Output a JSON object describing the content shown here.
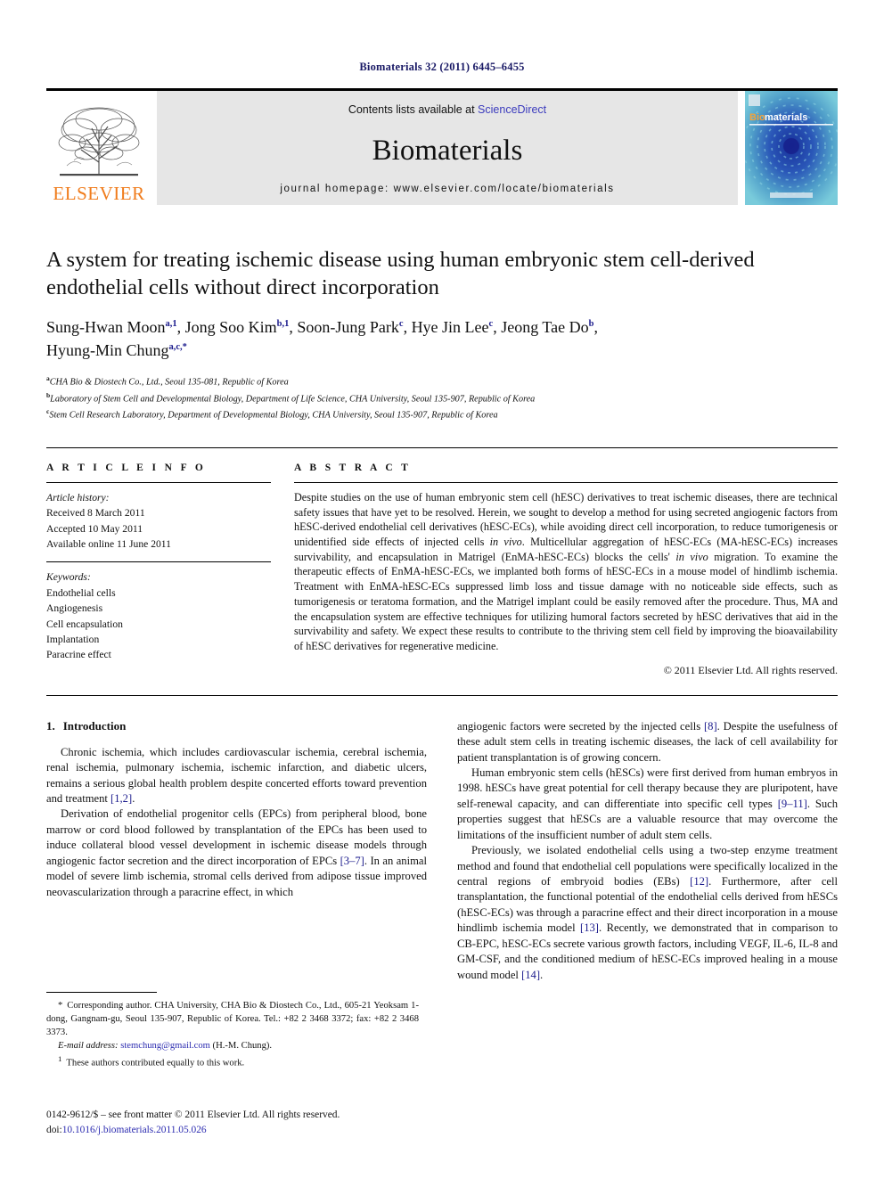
{
  "running_head": "Biomaterials 32 (2011) 6445–6455",
  "masthead": {
    "publisher_wordmark": "ELSEVIER",
    "contents_prefix": "Contents lists available at ",
    "contents_link": "ScienceDirect",
    "journal_name": "Biomaterials",
    "homepage_line": "journal homepage: www.elsevier.com/locate/biomaterials",
    "cover_title_prefix": "Bio",
    "cover_title_suffix": "materials",
    "accent_orange": "#f07c1c",
    "link_blue": "#3b3bbd",
    "cover_teal": "#6fc6d9",
    "cover_blue": "#1b3fa0"
  },
  "article": {
    "title": "A system for treating ischemic disease using human embryonic stem cell-derived endothelial cells without direct incorporation",
    "authors_line_1": "Sung-Hwan Moon",
    "authors": [
      {
        "name": "Sung-Hwan Moon",
        "sup": "a,1"
      },
      {
        "name": "Jong Soo Kim",
        "sup": "b,1"
      },
      {
        "name": "Soon-Jung Park",
        "sup": "c"
      },
      {
        "name": "Hye Jin Lee",
        "sup": "c"
      },
      {
        "name": "Jeong Tae Do",
        "sup": "b"
      },
      {
        "name": "Hyung-Min Chung",
        "sup": "a,c,*"
      }
    ],
    "affiliations": [
      {
        "mark": "a",
        "text": "CHA Bio & Diostech Co., Ltd., Seoul 135-081, Republic of Korea"
      },
      {
        "mark": "b",
        "text": "Laboratory of Stem Cell and Developmental Biology, Department of Life Science, CHA University, Seoul 135-907, Republic of Korea"
      },
      {
        "mark": "c",
        "text": "Stem Cell Research Laboratory, Department of Developmental Biology, CHA University, Seoul 135-907, Republic of Korea"
      }
    ]
  },
  "article_info": {
    "heading": "A R T I C L E   I N F O",
    "history_label": "Article history:",
    "history": [
      "Received 8 March 2011",
      "Accepted 10 May 2011",
      "Available online 11 June 2011"
    ],
    "keywords_label": "Keywords:",
    "keywords": [
      "Endothelial cells",
      "Angiogenesis",
      "Cell encapsulation",
      "Implantation",
      "Paracrine effect"
    ]
  },
  "abstract": {
    "heading": "A B S T R A C T",
    "paragraph_1": "Despite studies on the use of human embryonic stem cell (hESC) derivatives to treat ischemic diseases, there are technical safety issues that have yet to be resolved. Herein, we sought to develop a method for using secreted angiogenic factors from hESC-derived endothelial cell derivatives (hESC-ECs), while avoiding direct cell incorporation, to reduce tumorigenesis or unidentified side effects of injected cells ",
    "italic_1": "in vivo",
    "paragraph_2": ". Multicellular aggregation of hESC-ECs (MA-hESC-ECs) increases survivability, and encapsulation in Matrigel (EnMA-hESC-ECs) blocks the cells' ",
    "italic_2": "in vivo",
    "paragraph_3": " migration. To examine the therapeutic effects of EnMA-hESC-ECs, we implanted both forms of hESC-ECs in a mouse model of hindlimb ischemia. Treatment with EnMA-hESC-ECs suppressed limb loss and tissue damage with no noticeable side effects, such as tumorigenesis or teratoma formation, and the Matrigel implant could be easily removed after the procedure. Thus, MA and the encapsulation system are effective techniques for utilizing humoral factors secreted by hESC derivatives that aid in the survivability and safety. We expect these results to contribute to the thriving stem cell field by improving the bioavailability of hESC derivatives for regenerative medicine.",
    "copyright": "© 2011 Elsevier Ltd. All rights reserved."
  },
  "introduction": {
    "section_number": "1.",
    "section_title": "Introduction",
    "left_p1_a": "Chronic ischemia, which includes cardiovascular ischemia, cerebral ischemia, renal ischemia, pulmonary ischemia, ischemic infarction, and diabetic ulcers, remains a serious global health problem despite concerted efforts toward prevention and treatment ",
    "left_p1_cite": "[1,2]",
    "left_p1_b": ".",
    "left_p2_a": "Derivation of endothelial progenitor cells (EPCs) from peripheral blood, bone marrow or cord blood followed by transplantation of the EPCs has been used to induce collateral blood vessel development in ischemic disease models through angiogenic factor secretion and the direct incorporation of EPCs ",
    "left_p2_cite": "[3–7]",
    "left_p2_b": ". In an animal model of severe limb ischemia, stromal cells derived from adipose tissue improved neovascularization through a paracrine effect, in which",
    "right_p1_a": "angiogenic factors were secreted by the injected cells ",
    "right_p1_cite": "[8]",
    "right_p1_b": ". Despite the usefulness of these adult stem cells in treating ischemic diseases, the lack of cell availability for patient transplantation is of growing concern.",
    "right_p2_a": "Human embryonic stem cells (hESCs) were first derived from human embryos in 1998. hESCs have great potential for cell therapy because they are pluripotent, have self-renewal capacity, and can differentiate into specific cell types ",
    "right_p2_cite": "[9–11]",
    "right_p2_b": ". Such properties suggest that hESCs are a valuable resource that may overcome the limitations of the insufficient number of adult stem cells.",
    "right_p3_a": "Previously, we isolated endothelial cells using a two-step enzyme treatment method and found that endothelial cell populations were specifically localized in the central regions of embryoid bodies (EBs) ",
    "right_p3_cite1": "[12]",
    "right_p3_b": ". Furthermore, after cell transplantation, the functional potential of the endothelial cells derived from hESCs (hESC-ECs) was through a paracrine effect and their direct incorporation in a mouse hindlimb ischemia model ",
    "right_p3_cite2": "[13]",
    "right_p3_c": ". Recently, we demonstrated that in comparison to CB-EPC, hESC-ECs secrete various growth factors, including VEGF, IL-6, IL-8 and GM-CSF, and the conditioned medium of hESC-ECs improved healing in a mouse wound model ",
    "right_p3_cite3": "[14]",
    "right_p3_d": "."
  },
  "footnotes": {
    "corresponding_mark": "*",
    "corresponding_text": "Corresponding author. CHA University, CHA Bio & Diostech Co., Ltd., 605-21 Yeoksam 1-dong, Gangnam-gu, Seoul 135-907, Republic of Korea. Tel.: +82 2 3468 3372; fax: +82 2 3468 3373.",
    "email_label": "E-mail address:",
    "email_address": "stemchung@gmail.com",
    "email_suffix": " (H.-M. Chung).",
    "equal_mark": "1",
    "equal_text": "These authors contributed equally to this work."
  },
  "imprint": {
    "line1": "0142-9612/$ – see front matter © 2011 Elsevier Ltd. All rights reserved.",
    "doi_label": "doi:",
    "doi_value": "10.1016/j.biomaterials.2011.05.026"
  }
}
